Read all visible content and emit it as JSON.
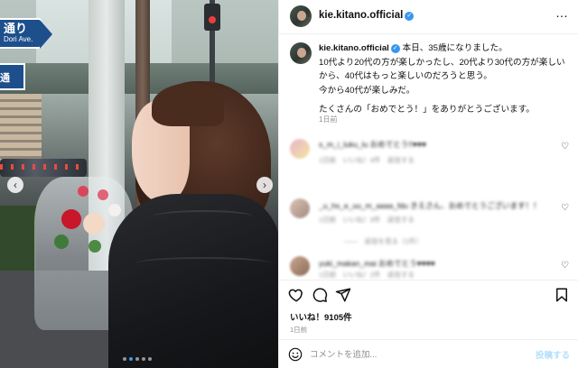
{
  "photo": {
    "sign_main": "通り",
    "sign_sub": "Dori Ave.",
    "sign_secondary": "通",
    "nav_prev": "‹",
    "nav_next": "›",
    "carousel_index": 1,
    "carousel_count": 5
  },
  "header": {
    "username": "kie.kitano.official",
    "verified_glyph": "✓",
    "more_glyph": "…"
  },
  "caption": {
    "username": "kie.kitano.official",
    "lines": [
      "本日、35歳になりました。",
      "10代より20代の方が楽しかったし、20代より30代の方が楽しい",
      "から、40代はもっと楽しいのだろうと思う。",
      "今から40代が楽しみだ。"
    ],
    "line_after_gap": "たくさんの「おめでとう！」をありがとうございます。",
    "time": "1日前"
  },
  "comments": [
    {
      "text": "s_m_i_luku_lu おめでとう!!♥♥♥",
      "meta": "1日前　いいね！4件　返信する",
      "reply": "",
      "heart_glyph": "♡",
      "colors": [
        "#e6b4c8",
        "#f4e6a2"
      ]
    },
    {
      "text": "_u_hs_e_uu_m_aaaa_fdu きえさん、おめでとうございます！！",
      "meta": "1日前　いいね！3件　返信する",
      "reply": "――　返信を見る（1件）",
      "heart_glyph": "♡",
      "colors": [
        "#d9c2b6",
        "#a28a7e"
      ]
    },
    {
      "text": "yuki_makan_mai おめでとう♥♥♥♥",
      "meta": "1日前　いいね！2件　返信する",
      "reply": "",
      "heart_glyph": "♡",
      "colors": [
        "#caa890",
        "#8b6a58"
      ]
    }
  ],
  "actions": {
    "likes": "いいね！9105件",
    "date": "1日前"
  },
  "comment_box": {
    "placeholder": "コメントを追加...",
    "post_label": "投稿する"
  },
  "colors": {
    "accent": "#3897f0",
    "post_disabled": "#b2dffc",
    "heart_red": "#ed4956",
    "muted": "#8e8e8e"
  }
}
